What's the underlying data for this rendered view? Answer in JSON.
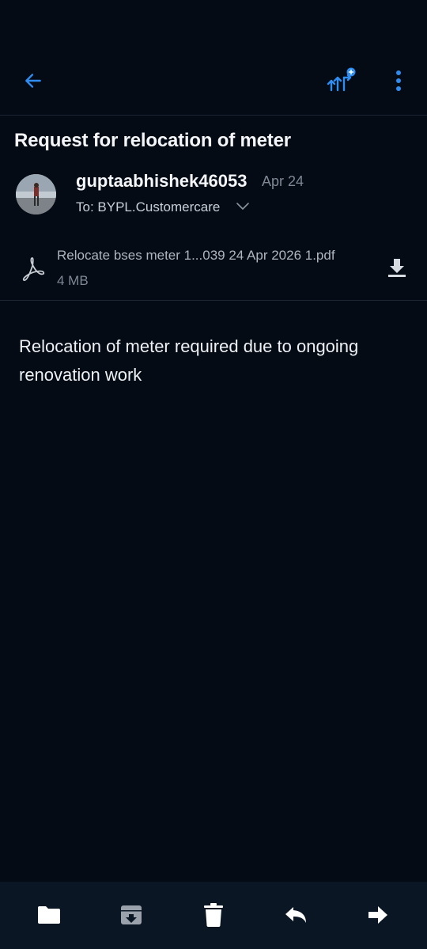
{
  "header": {
    "back_icon": "arrow-left-icon",
    "filter_icon": "split-arrows-add-icon",
    "more_icon": "more-vertical-icon",
    "accent_color": "#2f8cf0"
  },
  "message": {
    "subject": "Request for relocation of meter",
    "sender": "guptaabhishek46053",
    "date": "Apr 24",
    "to_label": "To: BYPL.Customercare",
    "body": "Relocation of meter required due to ongoing renovation work"
  },
  "attachment": {
    "icon": "pdf-acrobat-icon",
    "name": "Relocate bses meter 1...039 24 Apr 2026 1.pdf",
    "size": "4 MB",
    "download_icon": "download-icon"
  },
  "bottom_bar": {
    "items": [
      {
        "name": "move-to-folder",
        "icon": "folder-icon"
      },
      {
        "name": "archive",
        "icon": "archive-icon"
      },
      {
        "name": "delete",
        "icon": "trash-icon"
      },
      {
        "name": "reply",
        "icon": "reply-icon"
      },
      {
        "name": "forward",
        "icon": "forward-icon"
      }
    ]
  }
}
